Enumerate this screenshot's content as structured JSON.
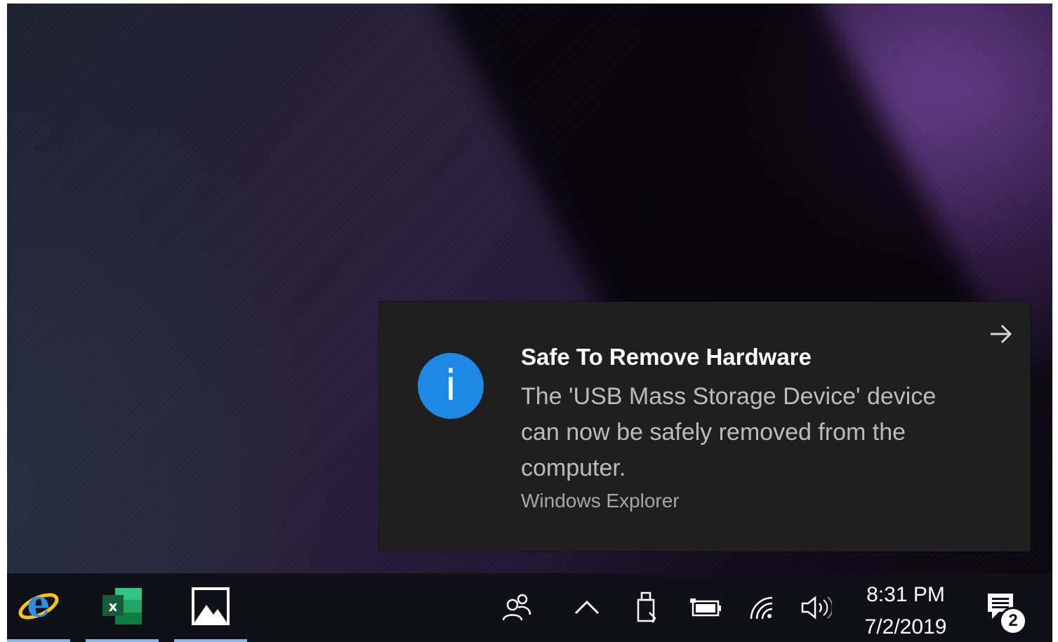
{
  "notification": {
    "title": "Safe To Remove Hardware",
    "body": "The 'USB Mass Storage Device' device can now be safely removed from the computer.",
    "source": "Windows Explorer",
    "icon": "info-icon",
    "expand_icon": "arrow-right-icon"
  },
  "taskbar": {
    "pinned_apps": [
      {
        "name": "Internet Explorer",
        "icon": "internet-explorer-icon"
      },
      {
        "name": "Excel",
        "icon": "excel-icon"
      },
      {
        "name": "Photos",
        "icon": "photos-icon"
      }
    ],
    "tray": {
      "icons": [
        "people-icon",
        "chevron-up-icon",
        "usb-drive-icon",
        "battery-icon",
        "wifi-icon",
        "volume-icon"
      ],
      "time": "8:31 PM",
      "date": "7/2/2019",
      "action_center_icon": "action-center-icon",
      "action_center_count": "2"
    }
  },
  "colors": {
    "toast_bg": "#1f1f1f",
    "info_blue": "#1e88e5",
    "taskbar_bg": "#101018"
  }
}
